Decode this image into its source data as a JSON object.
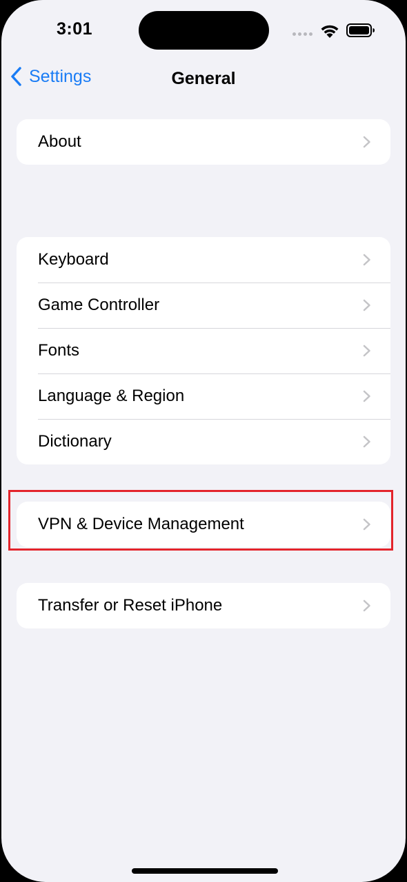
{
  "status_bar": {
    "time": "3:01",
    "signal_icon": "signal-dots-icon",
    "wifi_icon": "wifi-icon",
    "battery_icon": "battery-icon"
  },
  "nav": {
    "back_label": "Settings",
    "title": "General"
  },
  "groups": [
    {
      "items": [
        {
          "label": "About"
        }
      ]
    },
    {
      "items": [
        {
          "label": "Keyboard"
        },
        {
          "label": "Game Controller"
        },
        {
          "label": "Fonts"
        },
        {
          "label": "Language & Region"
        },
        {
          "label": "Dictionary"
        }
      ]
    },
    {
      "items": [
        {
          "label": "VPN & Device Management"
        }
      ]
    },
    {
      "items": [
        {
          "label": "Transfer or Reset iPhone"
        }
      ]
    }
  ],
  "colors": {
    "accent": "#1a7cf5",
    "background": "#f2f2f7",
    "highlight": "#e3242b"
  }
}
